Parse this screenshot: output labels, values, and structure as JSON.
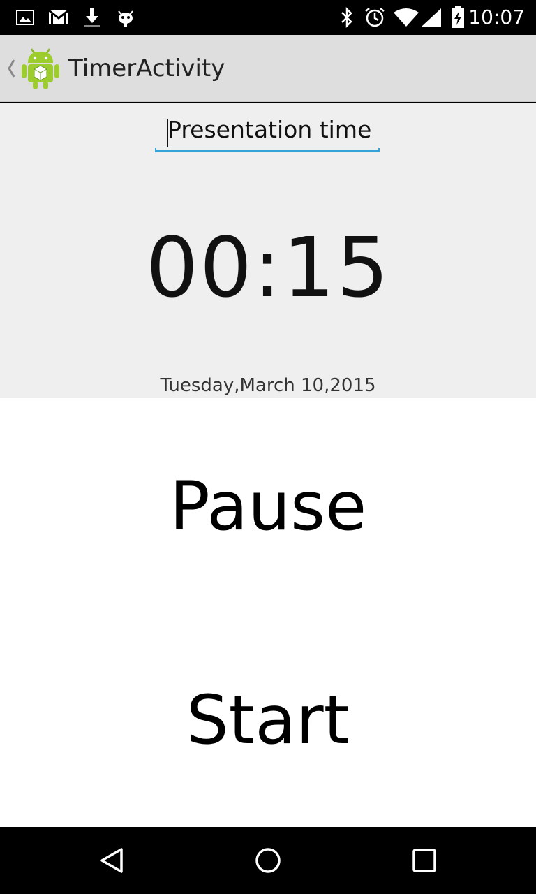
{
  "status_bar": {
    "time": "10:07",
    "left_icons": [
      "gallery-icon",
      "gmail-icon",
      "download-icon",
      "android-debug-icon"
    ],
    "right_icons": [
      "bluetooth-icon",
      "alarm-icon",
      "wifi-icon",
      "signal-icon",
      "battery-charging-icon"
    ]
  },
  "action_bar": {
    "title": "TimerActivity",
    "app_icon": "android-app-icon"
  },
  "timer": {
    "name_value": "Presentation time",
    "display": "00:15",
    "date": "Tuesday,March 10,2015"
  },
  "buttons": {
    "pause": "Pause",
    "start": "Start"
  },
  "nav_bar": {
    "icons": [
      "back-icon",
      "home-icon",
      "recents-icon"
    ]
  },
  "colors": {
    "accent": "#33a3d9",
    "action_bar_bg": "#dedede",
    "top_section_bg": "#efefef"
  }
}
